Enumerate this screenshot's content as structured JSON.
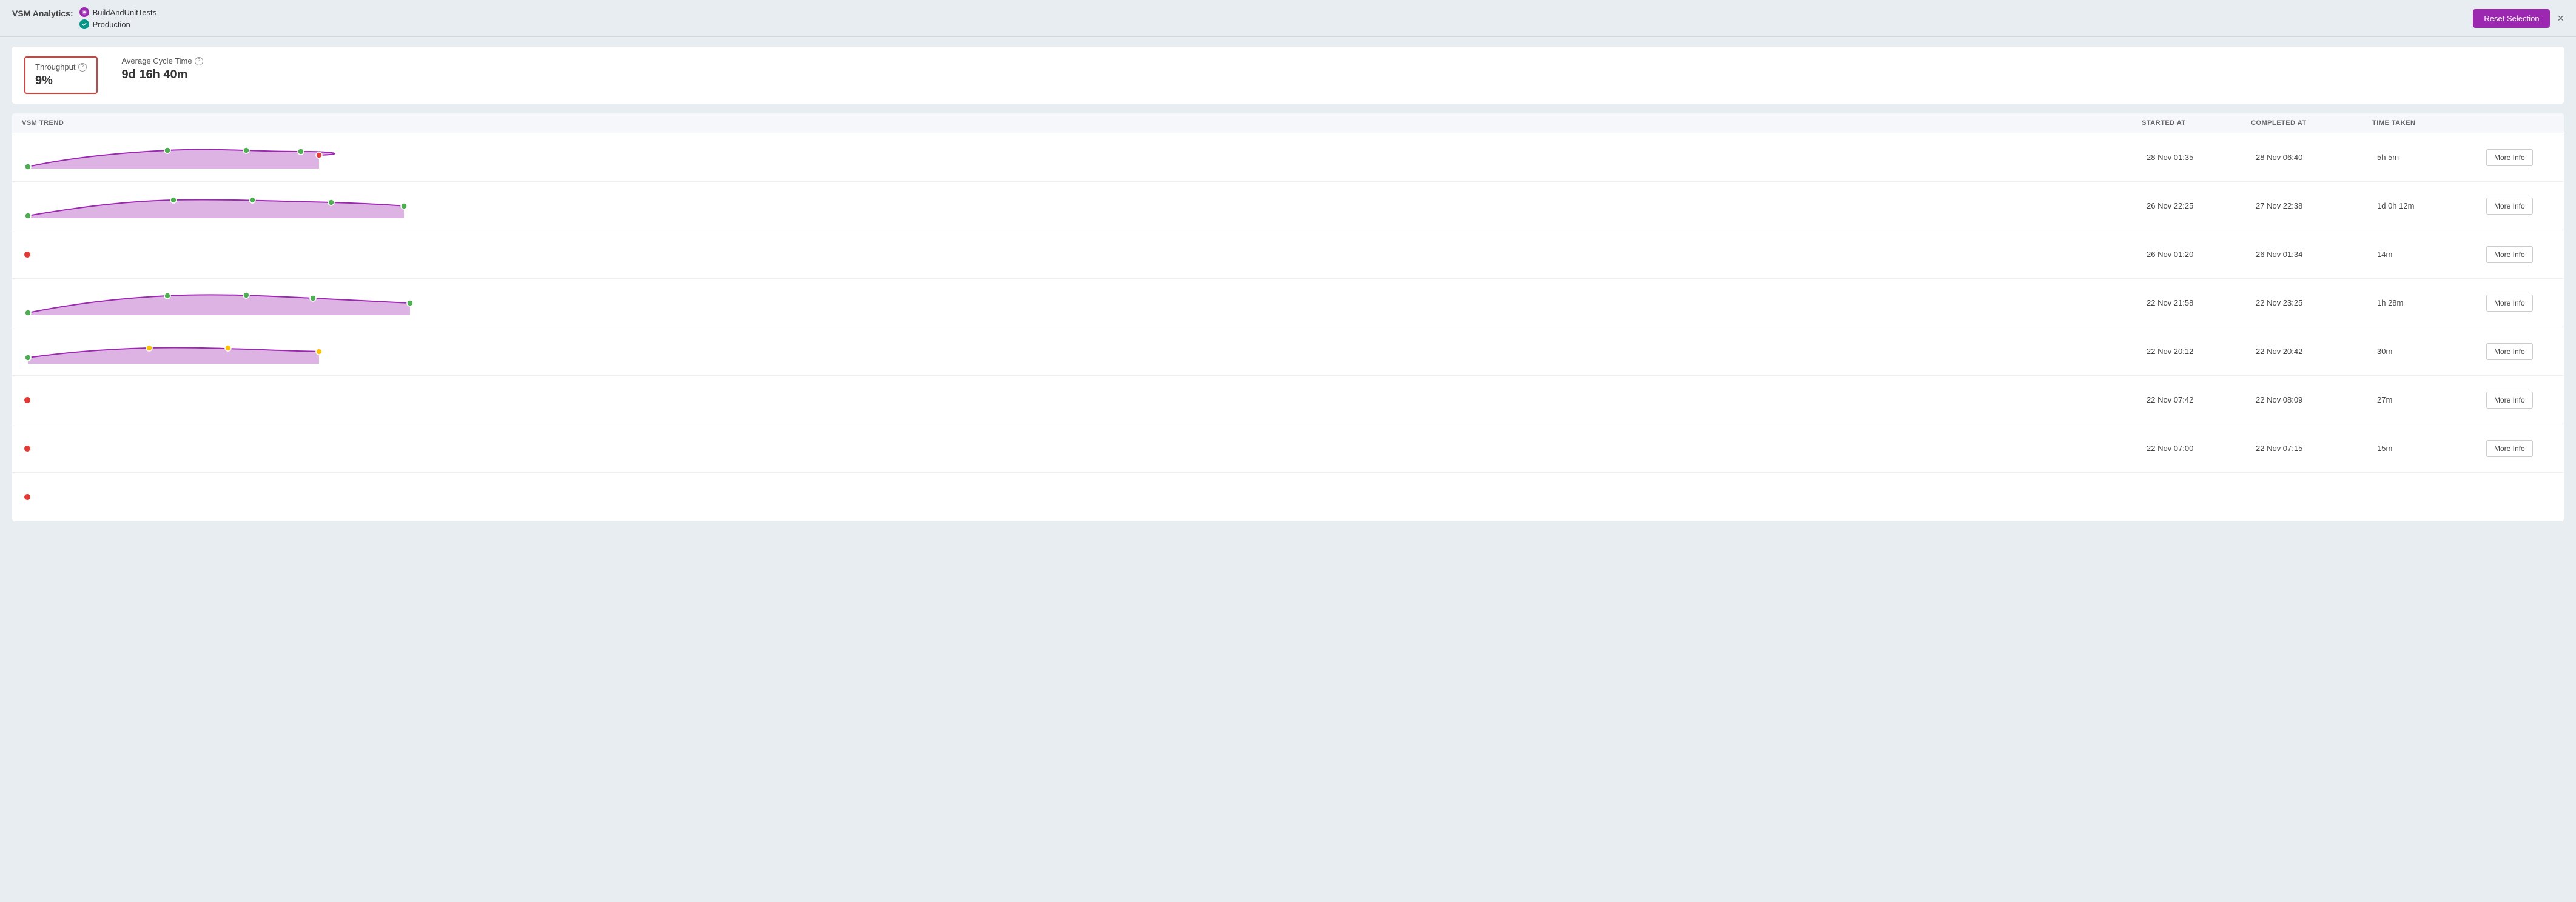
{
  "header": {
    "vsm_label": "VSM Analytics:",
    "pipelines": [
      {
        "name": "BuildAndUnitTests",
        "icon_type": "purple",
        "icon_char": "●"
      },
      {
        "name": "Production",
        "icon_type": "teal",
        "icon_char": "✓"
      }
    ],
    "reset_btn_label": "Reset Selection",
    "close_btn_label": "×"
  },
  "metrics": {
    "throughput_label": "Throughput",
    "throughput_value": "9%",
    "avg_cycle_label": "Average Cycle Time",
    "avg_cycle_value": "9d 16h 40m"
  },
  "table": {
    "columns": [
      "VSM TREND",
      "STARTED AT",
      "COMPLETED AT",
      "TIME TAKEN",
      ""
    ],
    "rows": [
      {
        "trend_type": "wave",
        "started_at": "28 Nov 01:35",
        "completed_at": "28 Nov 06:40",
        "time_taken": "5h 5m",
        "show_btn": true
      },
      {
        "trend_type": "wave2",
        "started_at": "26 Nov 22:25",
        "completed_at": "27 Nov 22:38",
        "time_taken": "1d 0h 12m",
        "show_btn": true
      },
      {
        "trend_type": "dot",
        "started_at": "26 Nov 01:20",
        "completed_at": "26 Nov 01:34",
        "time_taken": "14m",
        "show_btn": true
      },
      {
        "trend_type": "wave3",
        "started_at": "22 Nov 21:58",
        "completed_at": "22 Nov 23:25",
        "time_taken": "1h 28m",
        "show_btn": true
      },
      {
        "trend_type": "wave4",
        "started_at": "22 Nov 20:12",
        "completed_at": "22 Nov 20:42",
        "time_taken": "30m",
        "show_btn": true
      },
      {
        "trend_type": "dot",
        "started_at": "22 Nov 07:42",
        "completed_at": "22 Nov 08:09",
        "time_taken": "27m",
        "show_btn": true
      },
      {
        "trend_type": "dot",
        "started_at": "22 Nov 07:00",
        "completed_at": "22 Nov 07:15",
        "time_taken": "15m",
        "show_btn": true
      },
      {
        "trend_type": "dot",
        "started_at": "",
        "completed_at": "",
        "time_taken": "",
        "show_btn": false
      }
    ],
    "more_info_label": "More Info"
  }
}
